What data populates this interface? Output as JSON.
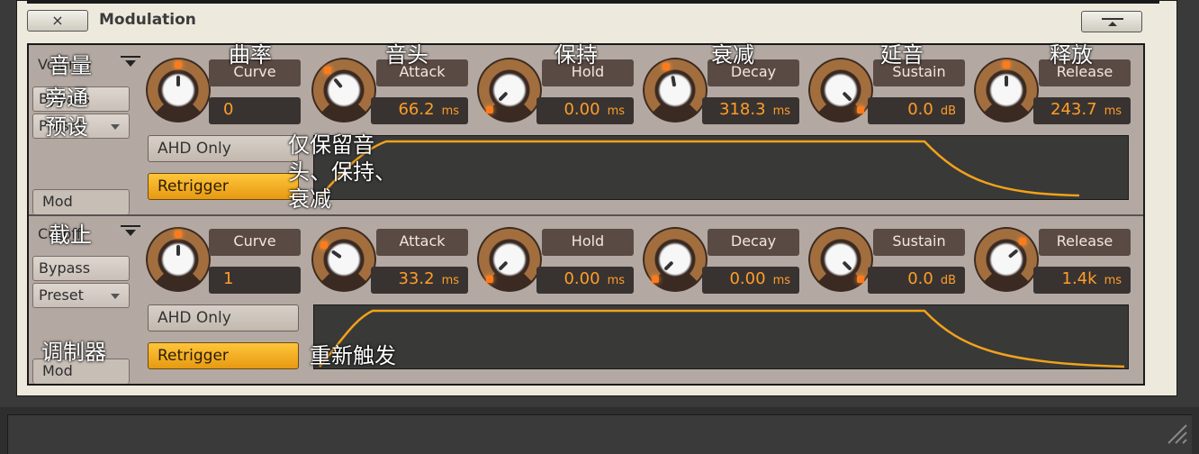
{
  "window": {
    "title": "Modulation",
    "close_label": "×"
  },
  "accent_color": "#f2a21a",
  "sections": [
    {
      "name": "Volume",
      "name_overlay": "音量",
      "bypass_label": "Bypass",
      "bypass_overlay": "旁通",
      "preset_label": "Preset",
      "preset_overlay": "预设",
      "mod_tab_label": "Mod",
      "ahd_label": "AHD Only",
      "retrigger_label": "Retrigger",
      "knobs": [
        {
          "label": "Curve",
          "overlay": "曲率",
          "value": "0",
          "unit": ""
        },
        {
          "label": "Attack",
          "overlay": "音头",
          "value": "66.2",
          "unit": "ms"
        },
        {
          "label": "Hold",
          "overlay": "保持",
          "value": "0.00",
          "unit": "ms"
        },
        {
          "label": "Decay",
          "overlay": "衰减",
          "value": "318.3",
          "unit": "ms"
        },
        {
          "label": "Sustain",
          "overlay": "延音",
          "value": "0.0",
          "unit": "dB"
        },
        {
          "label": "Release",
          "overlay": "释放",
          "value": "243.7",
          "unit": "ms"
        }
      ]
    },
    {
      "name": "Cutoff",
      "name_overlay": "截止",
      "bypass_label": "Bypass",
      "preset_label": "Preset",
      "mod_tab_label": "Mod",
      "mod_overlay": "调制器",
      "ahd_label": "AHD Only",
      "retrigger_label": "Retrigger",
      "knobs": [
        {
          "label": "Curve",
          "value": "1",
          "unit": ""
        },
        {
          "label": "Attack",
          "value": "33.2",
          "unit": "ms"
        },
        {
          "label": "Hold",
          "value": "0.00",
          "unit": "ms"
        },
        {
          "label": "Decay",
          "value": "0.00",
          "unit": "ms"
        },
        {
          "label": "Sustain",
          "value": "0.0",
          "unit": "dB"
        },
        {
          "label": "Release",
          "value": "1.4k",
          "unit": "ms"
        }
      ]
    }
  ],
  "annotations": {
    "ahd_only": "仅保留音头、保持、衰减",
    "retrigger": "重新触发"
  }
}
